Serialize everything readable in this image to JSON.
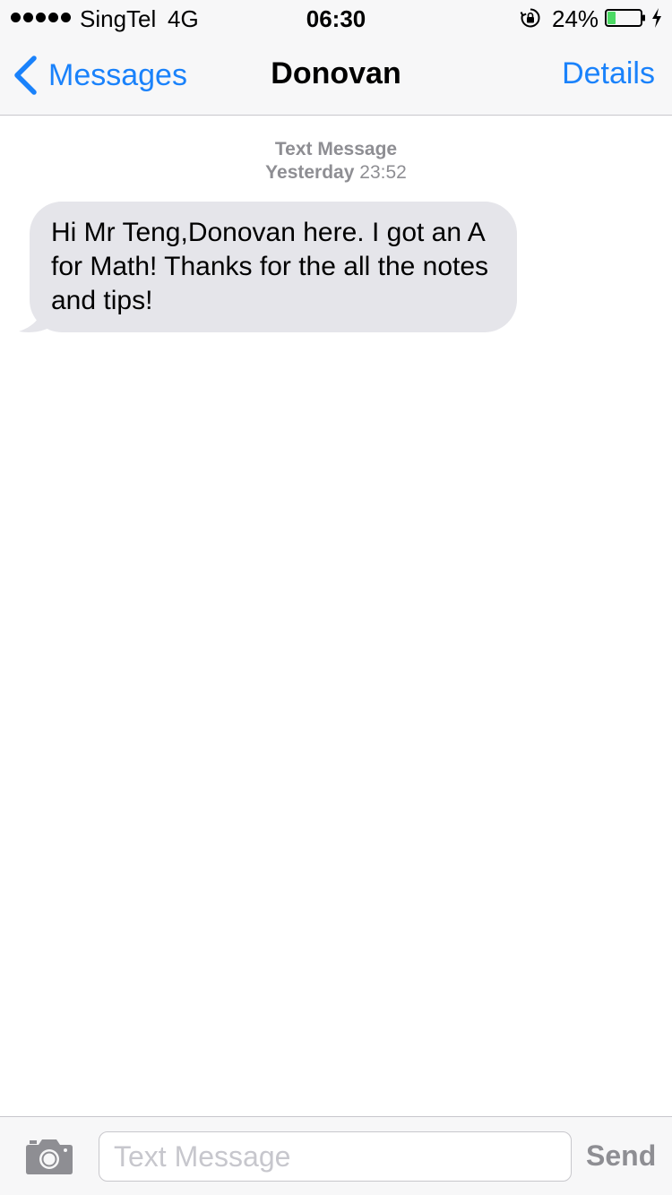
{
  "status_bar": {
    "carrier": "SingTel",
    "network": "4G",
    "time": "06:30",
    "battery_percent": "24%",
    "battery_level": 0.24,
    "battery_color": "#4cd964",
    "icons": [
      "signal-dots",
      "lock-rotation-icon",
      "battery-icon",
      "charging-icon"
    ]
  },
  "nav": {
    "back_label": "Messages",
    "title": "Donovan",
    "details_label": "Details",
    "accent_color": "#1a82fb"
  },
  "conversation": {
    "service_label": "Text Message",
    "timestamp_day": "Yesterday",
    "timestamp_time": "23:52",
    "messages": [
      {
        "direction": "incoming",
        "text": "Hi Mr Teng,Donovan here. I got an A for Math! Thanks for the all the notes and tips!"
      }
    ]
  },
  "input_bar": {
    "placeholder": "Text Message",
    "value": "",
    "send_label": "Send",
    "camera_icon": "camera-icon"
  }
}
